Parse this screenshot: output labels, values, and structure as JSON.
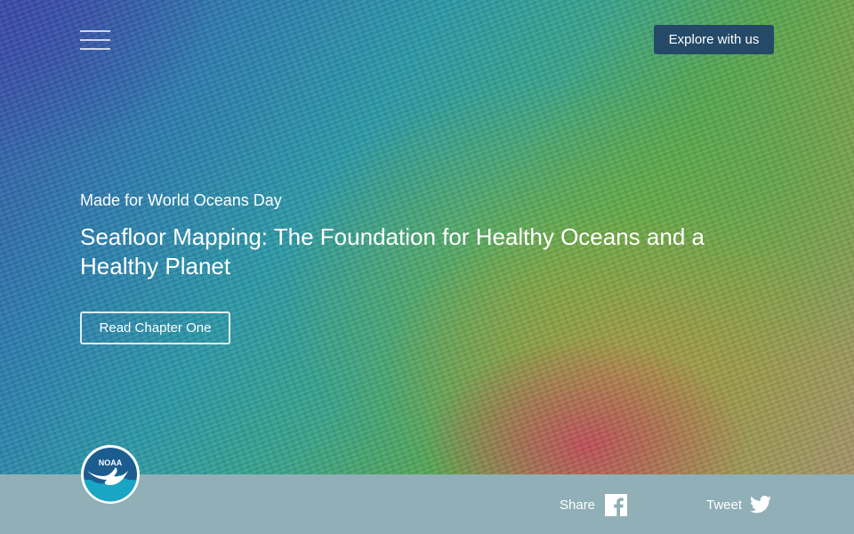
{
  "header": {
    "menu_icon": "hamburger-menu-icon",
    "cta_label": "Explore with us",
    "cta_color": "#244a68"
  },
  "hero": {
    "kicker": "Made for World Oceans Day",
    "title": "Seafloor Mapping: The Foundation for Healthy Oceans and a Healthy Planet",
    "button_label": "Read Chapter One"
  },
  "footer": {
    "background": "#90afb7",
    "logo_text": "NOAA",
    "logo_icon": "noaa-logo",
    "share_label": "Share",
    "share_icon": "facebook-icon",
    "tweet_label": "Tweet",
    "tweet_icon": "twitter-icon"
  }
}
